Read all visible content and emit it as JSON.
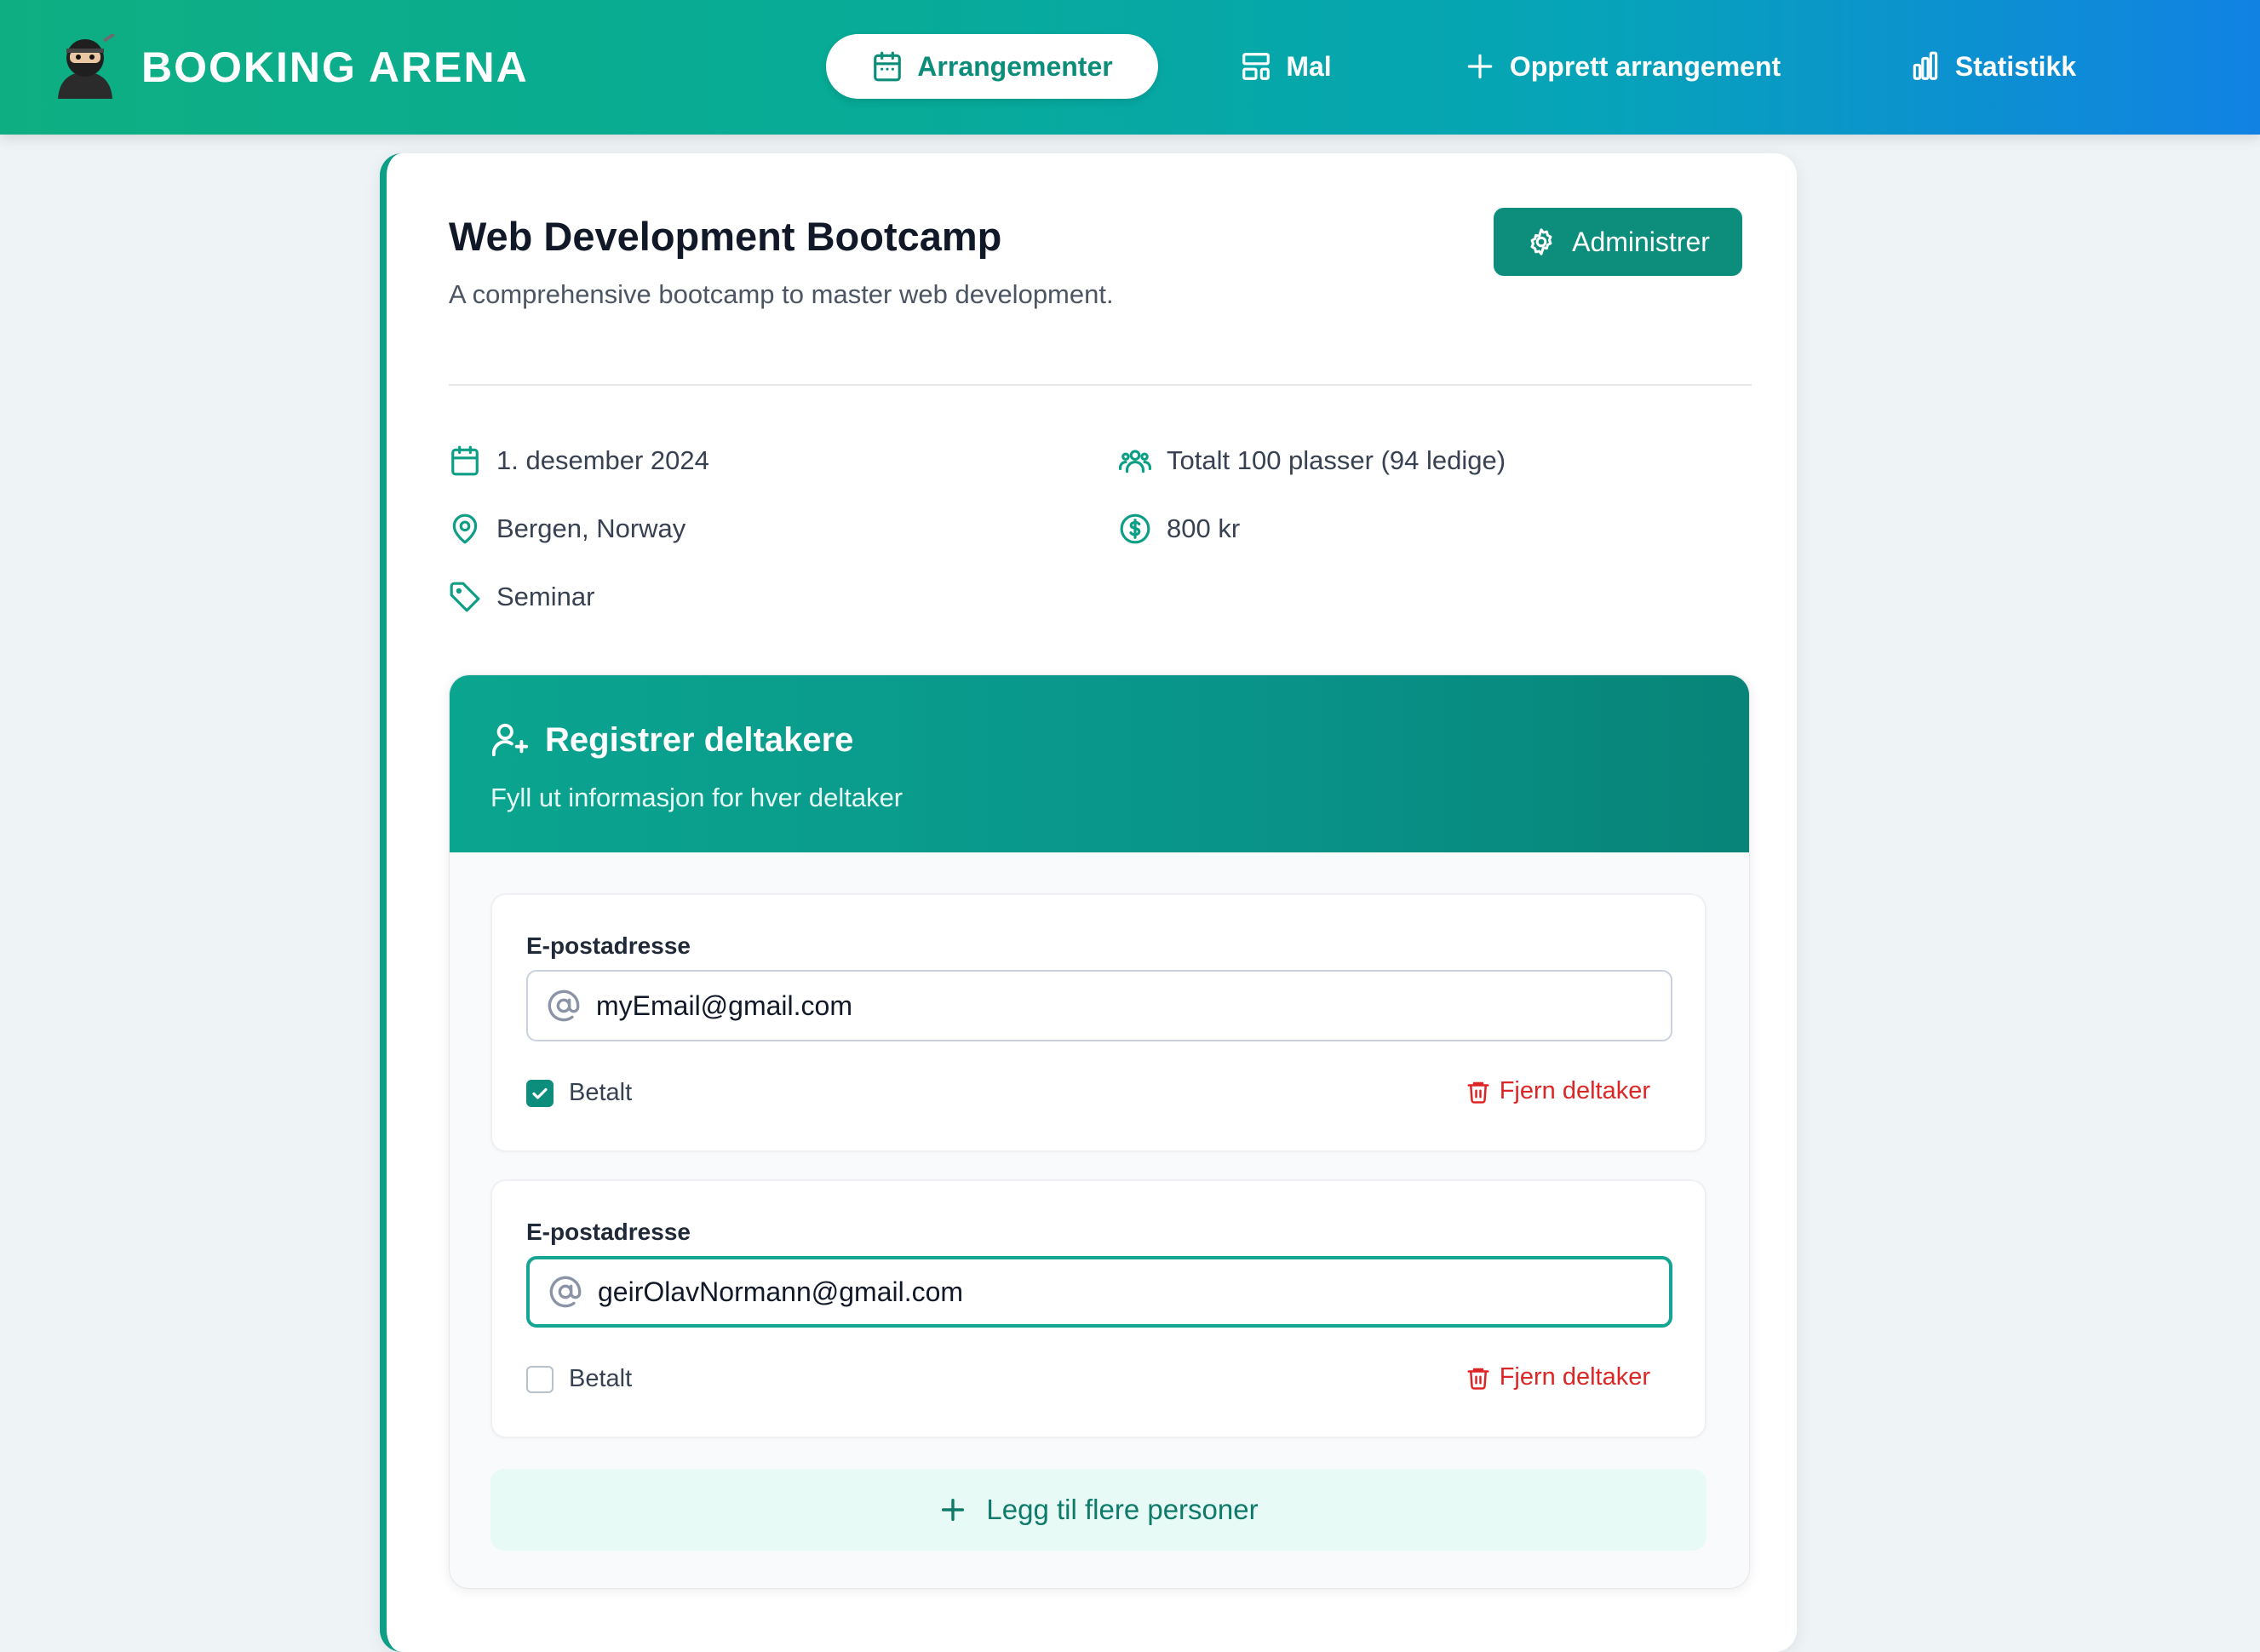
{
  "brand": "BOOKING ARENA",
  "nav": [
    {
      "label": "Arrangementer",
      "icon": "calendar-icon",
      "active": true
    },
    {
      "label": "Mal",
      "icon": "layout-template-icon",
      "active": false
    },
    {
      "label": "Opprett arrangement",
      "icon": "plus-icon",
      "active": false
    },
    {
      "label": "Statistikk",
      "icon": "bar-chart-icon",
      "active": false
    }
  ],
  "event": {
    "title": "Web Development Bootcamp",
    "description": "A comprehensive bootcamp to master web development.",
    "admin_label": "Administrer",
    "date": "1. desember 2024",
    "location": "Bergen, Norway",
    "category": "Seminar",
    "capacity": "Totalt 100 plasser (94 ledige)",
    "price": "800 kr"
  },
  "registration": {
    "title": "Registrer deltakere",
    "subtitle": "Fyll ut informasjon for hver deltaker",
    "participants": [
      {
        "email_label": "E-postadresse",
        "email": "myEmail@gmail.com",
        "paid_label": "Betalt",
        "paid": true,
        "remove_label": "Fjern deltaker",
        "focused": false
      },
      {
        "email_label": "E-postadresse",
        "email": "geirOlavNormann@gmail.com",
        "paid_label": "Betalt",
        "paid": false,
        "remove_label": "Fjern deltaker",
        "focused": true
      }
    ],
    "add_more_label": "Legg til flere personer"
  },
  "colors": {
    "accent": "#0d8e7c",
    "danger": "#dc2626",
    "header_gradient_start": "#0fae82",
    "header_gradient_end": "#1182e3"
  }
}
